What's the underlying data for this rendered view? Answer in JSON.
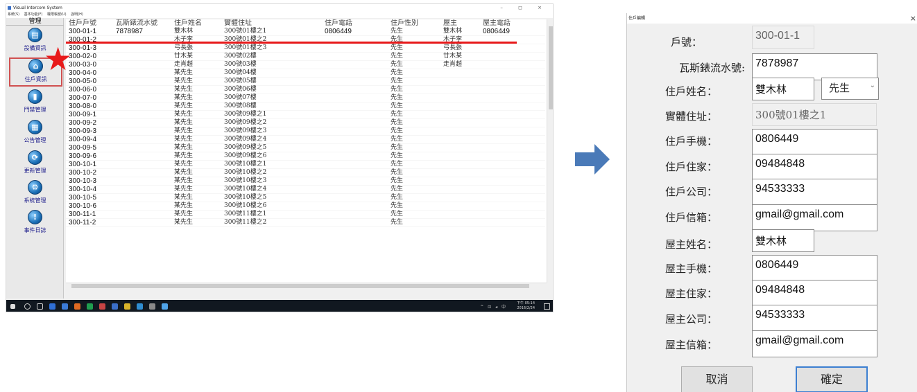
{
  "app": {
    "title": "Visual Intercom System",
    "window_controls": "– ◻ ×",
    "menu": [
      "系統(S)",
      "基本功能(F)",
      "權限帳號(U)",
      "說明(H)"
    ]
  },
  "sidebar": {
    "header": "管理",
    "items": [
      {
        "label": "設備資訊",
        "icon": "monitor-icon",
        "glyph": "▤"
      },
      {
        "label": "住戶資訊",
        "icon": "home-icon",
        "glyph": "⌂"
      },
      {
        "label": "門禁管理",
        "icon": "door-icon",
        "glyph": "▮"
      },
      {
        "label": "公告管理",
        "icon": "notice-icon",
        "glyph": "▦"
      },
      {
        "label": "更新管理",
        "icon": "refresh-icon",
        "glyph": "⟳"
      },
      {
        "label": "系統管理",
        "icon": "gear-icon",
        "glyph": "⚙"
      },
      {
        "label": "事件日誌",
        "icon": "alert-icon",
        "glyph": "!"
      }
    ]
  },
  "table": {
    "columns": [
      "住戶戶號",
      "瓦斯錶流水號",
      "住戶姓名",
      "實體住址",
      "住戶電話",
      "住戶性別",
      "屋主",
      "屋主電話"
    ],
    "rows": [
      [
        "300-01-1",
        "7878987",
        "雙木林",
        "300號01樓之1",
        "0806449",
        "先生",
        "雙木林",
        "0806449"
      ],
      [
        "300-01-2",
        "",
        "木子李",
        "300號01樓之2",
        "",
        "先生",
        "木子李",
        ""
      ],
      [
        "300-01-3",
        "",
        "弓長張",
        "300號01樓之3",
        "",
        "先生",
        "弓長張",
        ""
      ],
      [
        "300-02-0",
        "",
        "廿木某",
        "300號02樓",
        "",
        "先生",
        "廿木某",
        ""
      ],
      [
        "300-03-0",
        "",
        "走肖趙",
        "300號03樓",
        "",
        "先生",
        "走肖趙",
        ""
      ],
      [
        "300-04-0",
        "",
        "某先生",
        "300號04樓",
        "",
        "先生",
        "",
        ""
      ],
      [
        "300-05-0",
        "",
        "某先生",
        "300號05樓",
        "",
        "先生",
        "",
        ""
      ],
      [
        "300-06-0",
        "",
        "某先生",
        "300號06樓",
        "",
        "先生",
        "",
        ""
      ],
      [
        "300-07-0",
        "",
        "某先生",
        "300號07樓",
        "",
        "先生",
        "",
        ""
      ],
      [
        "300-08-0",
        "",
        "某先生",
        "300號08樓",
        "",
        "先生",
        "",
        ""
      ],
      [
        "300-09-1",
        "",
        "某先生",
        "300號09樓之1",
        "",
        "先生",
        "",
        ""
      ],
      [
        "300-09-2",
        "",
        "某先生",
        "300號09樓之2",
        "",
        "先生",
        "",
        ""
      ],
      [
        "300-09-3",
        "",
        "某先生",
        "300號09樓之3",
        "",
        "先生",
        "",
        ""
      ],
      [
        "300-09-4",
        "",
        "某先生",
        "300號09樓之4",
        "",
        "先生",
        "",
        ""
      ],
      [
        "300-09-5",
        "",
        "某先生",
        "300號09樓之5",
        "",
        "先生",
        "",
        ""
      ],
      [
        "300-09-6",
        "",
        "某先生",
        "300號09樓之6",
        "",
        "先生",
        "",
        ""
      ],
      [
        "300-10-1",
        "",
        "某先生",
        "300號10樓之1",
        "",
        "先生",
        "",
        ""
      ],
      [
        "300-10-2",
        "",
        "某先生",
        "300號10樓之2",
        "",
        "先生",
        "",
        ""
      ],
      [
        "300-10-3",
        "",
        "某先生",
        "300號10樓之3",
        "",
        "先生",
        "",
        ""
      ],
      [
        "300-10-4",
        "",
        "某先生",
        "300號10樓之4",
        "",
        "先生",
        "",
        ""
      ],
      [
        "300-10-5",
        "",
        "某先生",
        "300號10樓之5",
        "",
        "先生",
        "",
        ""
      ],
      [
        "300-10-6",
        "",
        "某先生",
        "300號10樓之6",
        "",
        "先生",
        "",
        ""
      ],
      [
        "300-11-1",
        "",
        "某先生",
        "300號11樓之1",
        "",
        "先生",
        "",
        ""
      ],
      [
        "300-11-2",
        "",
        "某先生",
        "300號11樓之2",
        "",
        "先生",
        "",
        ""
      ]
    ]
  },
  "taskbar": {
    "clock_time": "下午 05:14",
    "clock_date": "2016/2/24",
    "tray": "^ ⊡ ◂ 中"
  },
  "annotation": {
    "color": "#e8191a",
    "star_glyph": "★",
    "arrow_color": "#4a7ab8"
  },
  "dialog": {
    "title": "住戶編輯",
    "close_glyph": "×",
    "fields": {
      "unit_no": {
        "label": "戶號：",
        "value": "300-01-1"
      },
      "gas_meter": {
        "label": "瓦斯錶流水號:",
        "value": "7878987"
      },
      "resident_name": {
        "label": "住戶姓名：",
        "value": "雙木林"
      },
      "gender": {
        "value": "先生",
        "chevron": "⌄"
      },
      "address": {
        "label": "實體住址：",
        "value": "300號01樓之1"
      },
      "resident_mobile": {
        "label": "住戶手機：",
        "value": "0806449"
      },
      "resident_home": {
        "label": "住戶住家：",
        "value": "09484848"
      },
      "resident_office": {
        "label": "住戶公司：",
        "value": "94533333"
      },
      "resident_email": {
        "label": "住戶信箱：",
        "value": "gmail@gmail.com"
      },
      "owner_name": {
        "label": "屋主姓名：",
        "value": "雙木林"
      },
      "owner_mobile": {
        "label": "屋主手機：",
        "value": "0806449"
      },
      "owner_home": {
        "label": "屋主住家：",
        "value": "09484848"
      },
      "owner_office": {
        "label": "屋主公司：",
        "value": "94533333"
      },
      "owner_email": {
        "label": "屋主信箱：",
        "value": "gmail@gmail.com"
      }
    },
    "cancel_label": "取消",
    "ok_label": "確定"
  }
}
